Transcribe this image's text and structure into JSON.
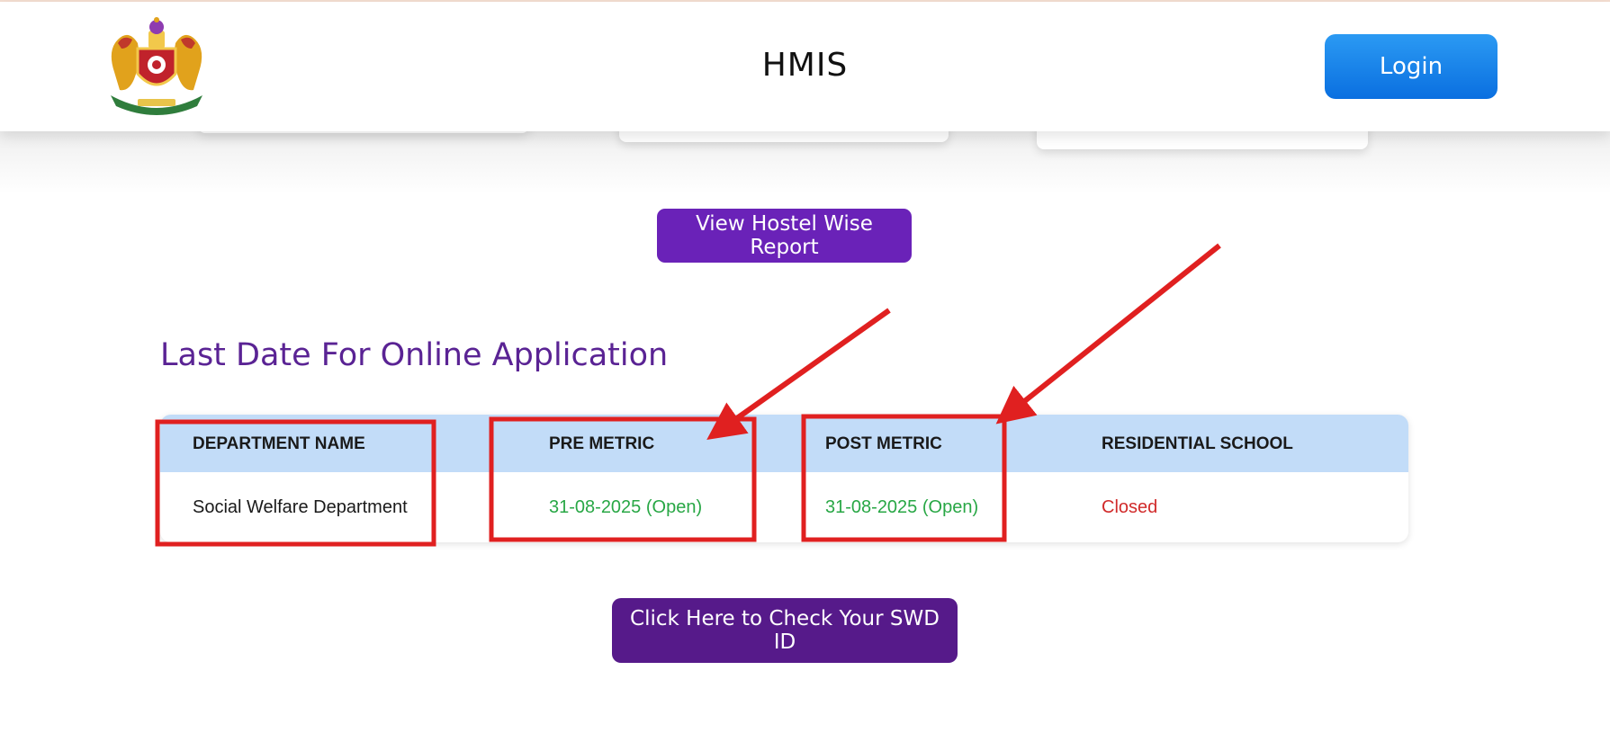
{
  "header": {
    "title": "HMIS",
    "login_label": "Login",
    "logo_icon": "karnataka-emblem-icon"
  },
  "actions": {
    "hostel_report_label": "View Hostel Wise Report",
    "check_swd_label": "Click Here to Check Your SWD ID"
  },
  "deadline": {
    "title": "Last Date For Online Application",
    "columns": [
      "DEPARTMENT NAME",
      "PRE METRIC",
      "POST METRIC",
      "RESIDENTIAL SCHOOL"
    ],
    "row": {
      "department": "Social Welfare Department",
      "pre_metric": "31-08-2025 (Open)",
      "post_metric": "31-08-2025 (Open)",
      "residential_school": "Closed"
    }
  },
  "colors": {
    "accent_purple": "#6a22b8",
    "title_purple": "#5a2394",
    "open_green": "#28a745",
    "closed_red": "#d12a2a",
    "annotation_red": "#e02020"
  }
}
